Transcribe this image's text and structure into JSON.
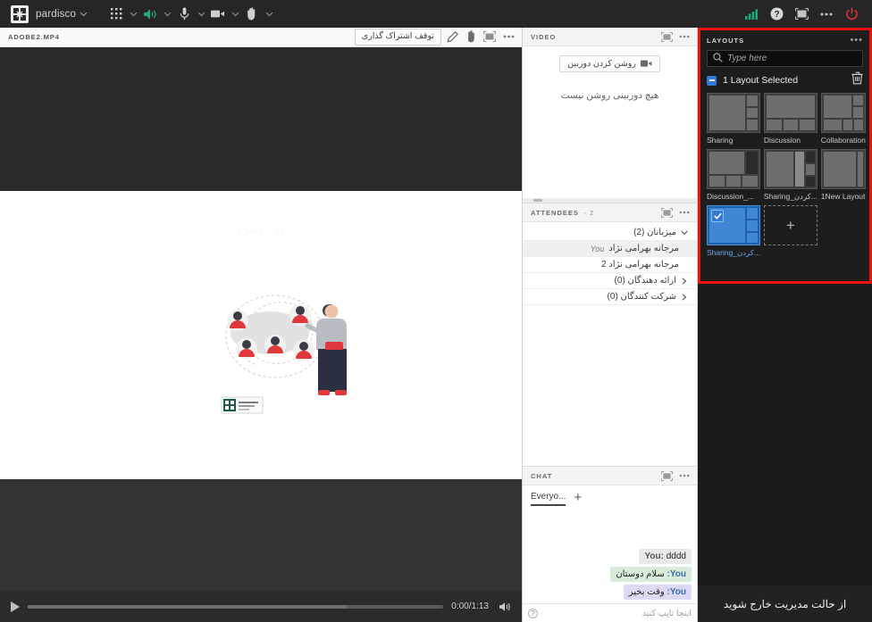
{
  "topbar": {
    "logo": "connect-logo-icon",
    "meeting_name": "pardisco",
    "controls": [
      {
        "name": "apps-grid-icon",
        "has_chevron": true
      },
      {
        "name": "speaker-icon",
        "has_chevron": true,
        "color": "#1fa97a"
      },
      {
        "name": "microphone-icon",
        "has_chevron": true
      },
      {
        "name": "camera-icon",
        "has_chevron": true
      },
      {
        "name": "raise-hand-icon",
        "has_chevron": true
      }
    ],
    "right_controls": [
      {
        "name": "network-signal-icon",
        "color": "#1fa97a"
      },
      {
        "name": "help-icon"
      },
      {
        "name": "fullscreen-icon"
      },
      {
        "name": "more-options-icon"
      },
      {
        "name": "end-session-icon",
        "color": "#d63333"
      }
    ]
  },
  "stage": {
    "title": "ADOBE2.MP4",
    "stop_share_label": "توقف اشتراک گذاری",
    "header_icons": [
      "draw-pen-icon",
      "pointer-hand-icon",
      "fullscreen-icon",
      "more-options-icon"
    ],
    "ghost_text": "پردیس",
    "controls": {
      "play_label": "play-icon",
      "time": "0:00/1:13",
      "progress_percent": 77,
      "volume_label": "volume-icon"
    }
  },
  "video_pod": {
    "title": "VIDEO",
    "start_camera_label": "روشن کردن دوربین",
    "empty_message": "هیچ دوربینی روشن نیست",
    "header_icons": [
      "fullscreen-icon",
      "more-options-icon"
    ]
  },
  "attendees_pod": {
    "title": "ATTENDEES",
    "count_label": "- 2",
    "header_icons": [
      "fullscreen-icon",
      "more-options-icon"
    ],
    "groups": [
      {
        "label": "میزبانان (2)",
        "expanded": true,
        "members": [
          {
            "name": "مرجانه بهرامی نژاد",
            "you_tag": "You",
            "selected": true
          },
          {
            "name": "مرجانه بهرامی نژاد 2",
            "you_tag": "",
            "selected": false
          }
        ]
      },
      {
        "label": "ارائه دهندگان (0)",
        "expanded": false,
        "members": []
      },
      {
        "label": "شرکت کنندگان (0)",
        "expanded": false,
        "members": []
      }
    ]
  },
  "chat_pod": {
    "title": "CHAT",
    "header_icons": [
      "fullscreen-icon",
      "more-options-icon"
    ],
    "tab_label": "Everyo...",
    "add_tab_label": "+",
    "messages": [
      {
        "who": "You:",
        "text": "dddd",
        "style": "g0"
      },
      {
        "who": "You:",
        "text": "سلام دوستان",
        "style": "g1"
      },
      {
        "who": "You:",
        "text": "وقت بخیر",
        "style": "g2"
      }
    ],
    "input_placeholder": "اینجا تایپ کنید",
    "input_value": ""
  },
  "layouts_panel": {
    "title": "LAYOUTS",
    "more_label": "•••",
    "search_placeholder": "Type here",
    "search_value": "",
    "selection_label": "1 Layout Selected",
    "delete_label": "trash-icon",
    "highlight_color": "#ee1111",
    "accent_color": "#2f7bd6",
    "items": [
      {
        "label": "Sharing",
        "selected": false,
        "pattern": "sharing"
      },
      {
        "label": "Discussion",
        "selected": false,
        "pattern": "discussion"
      },
      {
        "label": "Collaboration",
        "selected": false,
        "pattern": "collaboration"
      },
      {
        "label": "Discussion_...",
        "selected": false,
        "pattern": "discussion2"
      },
      {
        "label": "Sharing_کردن...",
        "selected": false,
        "pattern": "sharing2"
      },
      {
        "label": "1New Layout",
        "selected": false,
        "pattern": "new"
      },
      {
        "label": "Sharing_کردن...",
        "selected": true,
        "pattern": "sharing"
      }
    ],
    "add_layout_label": "+"
  },
  "footer": {
    "exit_management_label": "از حالت مدیریت خارج شوید"
  }
}
